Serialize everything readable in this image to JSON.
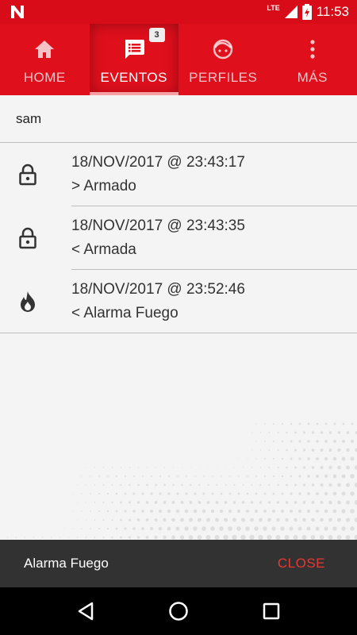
{
  "status_bar": {
    "network": "LTE",
    "time": "11:53",
    "icons": [
      "notification-n-icon",
      "signal-icon",
      "battery-charging-icon"
    ]
  },
  "tabs": [
    {
      "label": "HOME",
      "icon": "home-icon",
      "active": false
    },
    {
      "label": "EVENTOS",
      "icon": "list-chat-icon",
      "active": true,
      "badge": "3"
    },
    {
      "label": "PERFILES",
      "icon": "face-icon",
      "active": false
    },
    {
      "label": "MÁS",
      "icon": "more-vertical-icon",
      "active": false
    }
  ],
  "user": {
    "name": "sam"
  },
  "events": [
    {
      "icon": "lock-icon",
      "datetime": "18/NOV/2017 @ 23:43:17",
      "description": "> Armado"
    },
    {
      "icon": "lock-icon",
      "datetime": "18/NOV/2017 @ 23:43:35",
      "description": "< Armada"
    },
    {
      "icon": "fire-icon",
      "datetime": "18/NOV/2017 @ 23:52:46",
      "description": "< Alarma Fuego"
    }
  ],
  "snackbar": {
    "message": "Alarma Fuego",
    "action": "CLOSE"
  },
  "navigation": {
    "buttons": [
      "back-icon",
      "home-circle-icon",
      "recents-square-icon"
    ]
  },
  "colors": {
    "brand_red": "#e00f1c",
    "status_red": "#d80c18",
    "snackbar_bg": "#323232",
    "snackbar_action": "#e53935"
  }
}
